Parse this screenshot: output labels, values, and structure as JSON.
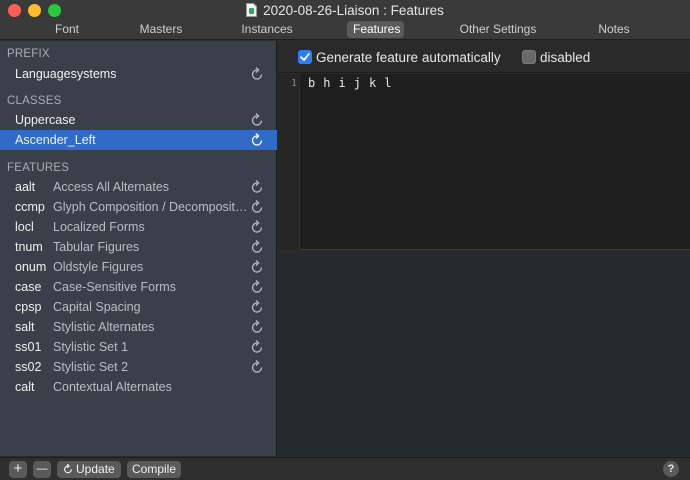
{
  "window": {
    "title": "2020-08-26-Liaison : Features"
  },
  "tabs": [
    {
      "label": "Font"
    },
    {
      "label": "Masters"
    },
    {
      "label": "Instances"
    },
    {
      "label": "Features",
      "active": true
    },
    {
      "label": "Other Settings"
    },
    {
      "label": "Notes"
    }
  ],
  "sidebar": {
    "prefix_header": "PREFIX",
    "prefix_items": [
      {
        "name": "Languagesystems"
      }
    ],
    "classes_header": "CLASSES",
    "classes_items": [
      {
        "name": "Uppercase"
      },
      {
        "name": "Ascender_Left",
        "selected": true
      }
    ],
    "features_header": "FEATURES",
    "features": [
      {
        "tag": "aalt",
        "desc": "Access All Alternates",
        "refresh": true
      },
      {
        "tag": "ccmp",
        "desc": "Glyph Composition / Decomposition",
        "refresh": true
      },
      {
        "tag": "locl",
        "desc": "Localized Forms",
        "refresh": true
      },
      {
        "tag": "tnum",
        "desc": "Tabular Figures",
        "refresh": true
      },
      {
        "tag": "onum",
        "desc": "Oldstyle Figures",
        "refresh": true
      },
      {
        "tag": "case",
        "desc": "Case-Sensitive Forms",
        "refresh": true
      },
      {
        "tag": "cpsp",
        "desc": "Capital Spacing",
        "refresh": true
      },
      {
        "tag": "salt",
        "desc": "Stylistic Alternates",
        "refresh": true
      },
      {
        "tag": "ss01",
        "desc": "Stylistic Set 1",
        "refresh": true
      },
      {
        "tag": "ss02",
        "desc": "Stylistic Set 2",
        "refresh": true
      },
      {
        "tag": "calt",
        "desc": "Contextual Alternates",
        "refresh": false
      }
    ]
  },
  "options": {
    "generate_label": "Generate feature automatically",
    "generate_checked": true,
    "disabled_label": "disabled",
    "disabled_checked": false
  },
  "editor": {
    "line_number": "1",
    "code": "b h i j k l"
  },
  "bottombar": {
    "add_label": "+",
    "remove_label": "—",
    "update_label": "Update",
    "compile_label": "Compile",
    "help_label": "?"
  },
  "colors": {
    "selection": "#2f6bc7",
    "checkbox_on": "#2f7cf6"
  }
}
